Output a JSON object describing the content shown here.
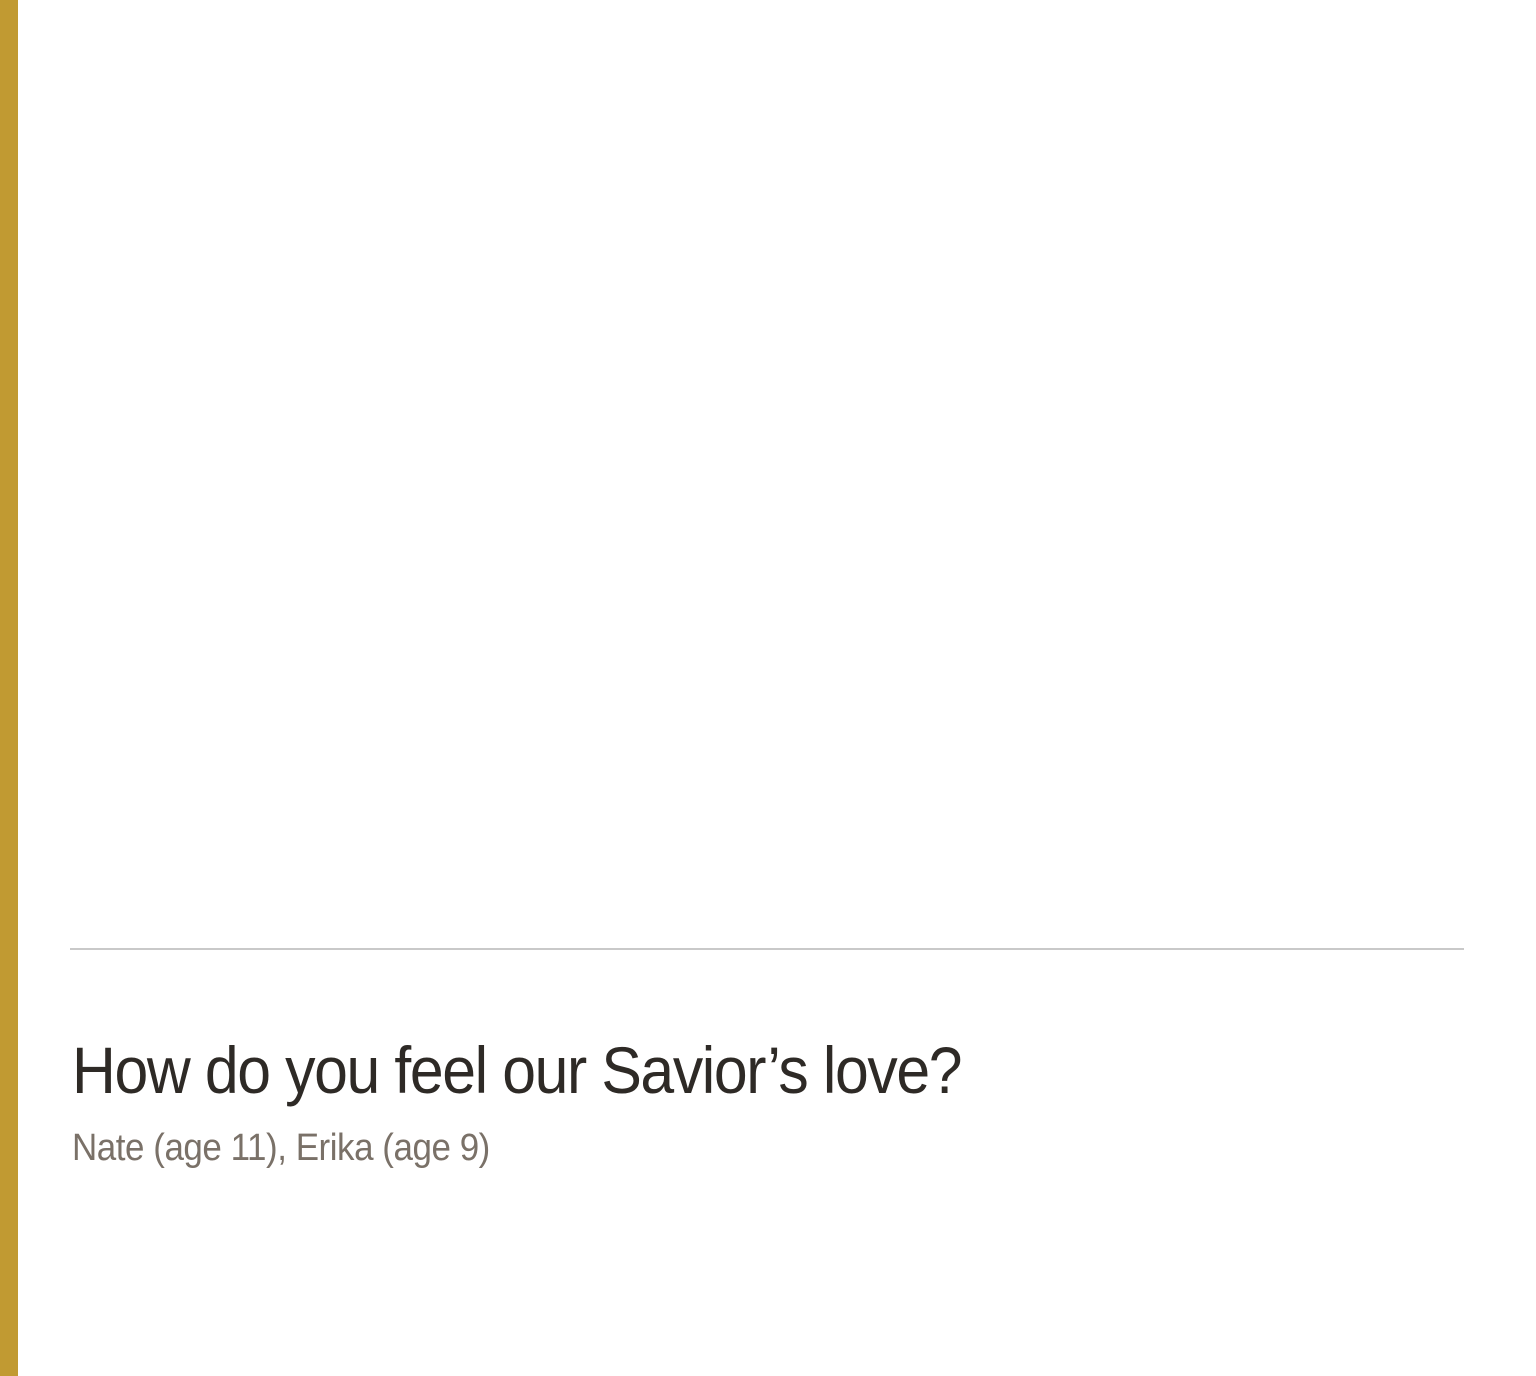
{
  "colors": {
    "accent_bar": "#c19a32",
    "title_text": "#2e2a26",
    "subtitle_text": "#7a7168",
    "divider": "#c9c9c9"
  },
  "article": {
    "title": "How do you feel our Savior’s love?",
    "byline": "Nate (age 11), Erika (age 9)"
  }
}
